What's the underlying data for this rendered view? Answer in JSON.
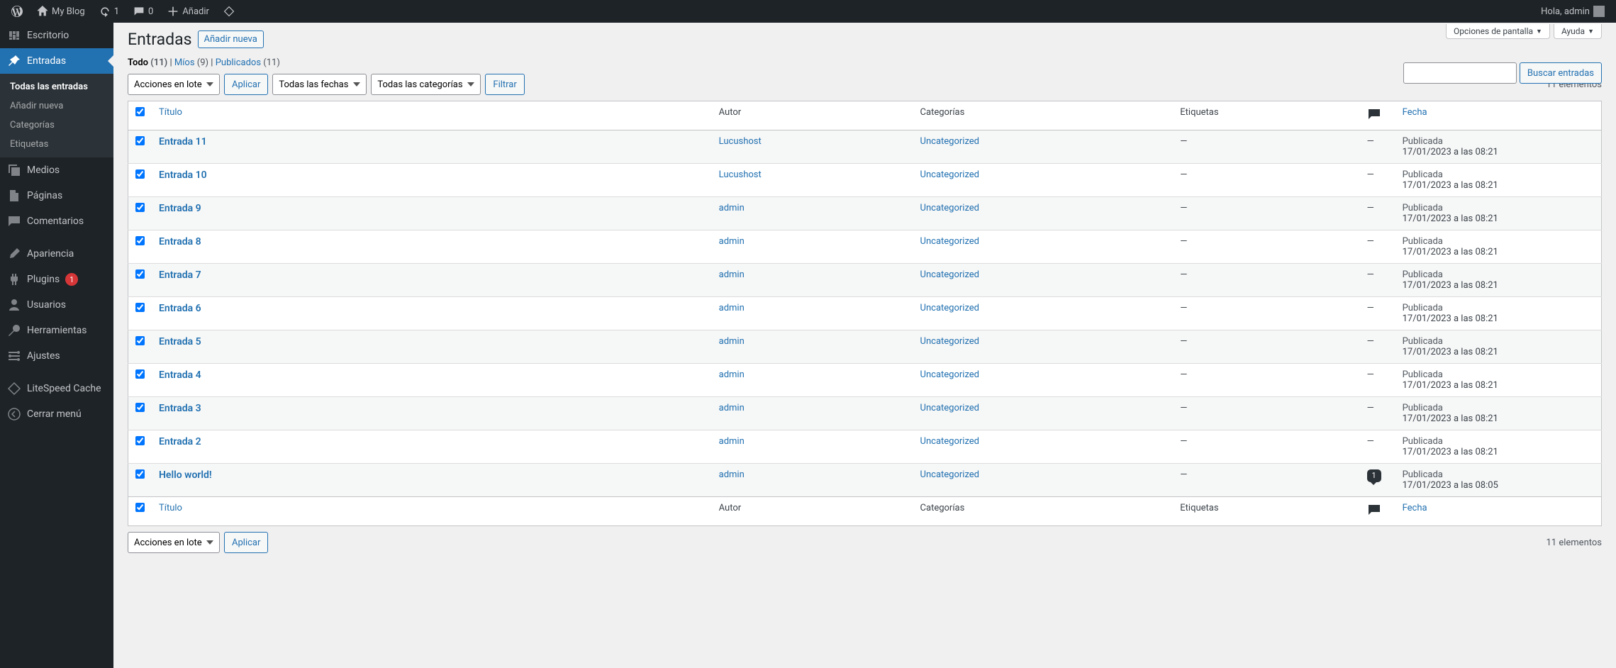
{
  "adminbar": {
    "site_name": "My Blog",
    "updates": "1",
    "comments": "0",
    "add_new": "Añadir",
    "greeting": "Hola, admin"
  },
  "screen_options": "Opciones de pantalla",
  "help": "Ayuda",
  "sidebar": {
    "dashboard": "Escritorio",
    "posts": "Entradas",
    "posts_sub": {
      "all": "Todas las entradas",
      "add": "Añadir nueva",
      "cats": "Categorías",
      "tags": "Etiquetas"
    },
    "media": "Medios",
    "pages": "Páginas",
    "comments": "Comentarios",
    "appearance": "Apariencia",
    "plugins": "Plugins",
    "plugins_badge": "1",
    "users": "Usuarios",
    "tools": "Herramientas",
    "settings": "Ajustes",
    "litespeed": "LiteSpeed Cache",
    "collapse": "Cerrar menú"
  },
  "page": {
    "title": "Entradas",
    "add_new": "Añadir nueva"
  },
  "views": {
    "all_label": "Todo",
    "all_count": "(11)",
    "mine_label": "Míos",
    "mine_count": "(9)",
    "pub_label": "Publicados",
    "pub_count": "(11)"
  },
  "filters": {
    "bulk": "Acciones en lote",
    "apply": "Aplicar",
    "dates": "Todas las fechas",
    "cats": "Todas las categorías",
    "filter": "Filtrar"
  },
  "search": {
    "button": "Buscar entradas"
  },
  "count_text": "11 elementos",
  "cols": {
    "title": "Título",
    "author": "Autor",
    "cats": "Categorías",
    "tags": "Etiquetas",
    "date": "Fecha"
  },
  "status_label": "Publicada",
  "rows": [
    {
      "title": "Entrada 11",
      "author": "Lucushost",
      "cat": "Uncategorized",
      "tags": "—",
      "comments": "—",
      "date": "17/01/2023 a las 08:21"
    },
    {
      "title": "Entrada 10",
      "author": "Lucushost",
      "cat": "Uncategorized",
      "tags": "—",
      "comments": "—",
      "date": "17/01/2023 a las 08:21"
    },
    {
      "title": "Entrada 9",
      "author": "admin",
      "cat": "Uncategorized",
      "tags": "—",
      "comments": "—",
      "date": "17/01/2023 a las 08:21"
    },
    {
      "title": "Entrada 8",
      "author": "admin",
      "cat": "Uncategorized",
      "tags": "—",
      "comments": "—",
      "date": "17/01/2023 a las 08:21"
    },
    {
      "title": "Entrada 7",
      "author": "admin",
      "cat": "Uncategorized",
      "tags": "—",
      "comments": "—",
      "date": "17/01/2023 a las 08:21"
    },
    {
      "title": "Entrada 6",
      "author": "admin",
      "cat": "Uncategorized",
      "tags": "—",
      "comments": "—",
      "date": "17/01/2023 a las 08:21"
    },
    {
      "title": "Entrada 5",
      "author": "admin",
      "cat": "Uncategorized",
      "tags": "—",
      "comments": "—",
      "date": "17/01/2023 a las 08:21"
    },
    {
      "title": "Entrada 4",
      "author": "admin",
      "cat": "Uncategorized",
      "tags": "—",
      "comments": "—",
      "date": "17/01/2023 a las 08:21"
    },
    {
      "title": "Entrada 3",
      "author": "admin",
      "cat": "Uncategorized",
      "tags": "—",
      "comments": "—",
      "date": "17/01/2023 a las 08:21"
    },
    {
      "title": "Entrada 2",
      "author": "admin",
      "cat": "Uncategorized",
      "tags": "—",
      "comments": "—",
      "date": "17/01/2023 a las 08:21"
    },
    {
      "title": "Hello world!",
      "author": "admin",
      "cat": "Uncategorized",
      "tags": "—",
      "comments": "1",
      "date": "17/01/2023 a las 08:05"
    }
  ]
}
